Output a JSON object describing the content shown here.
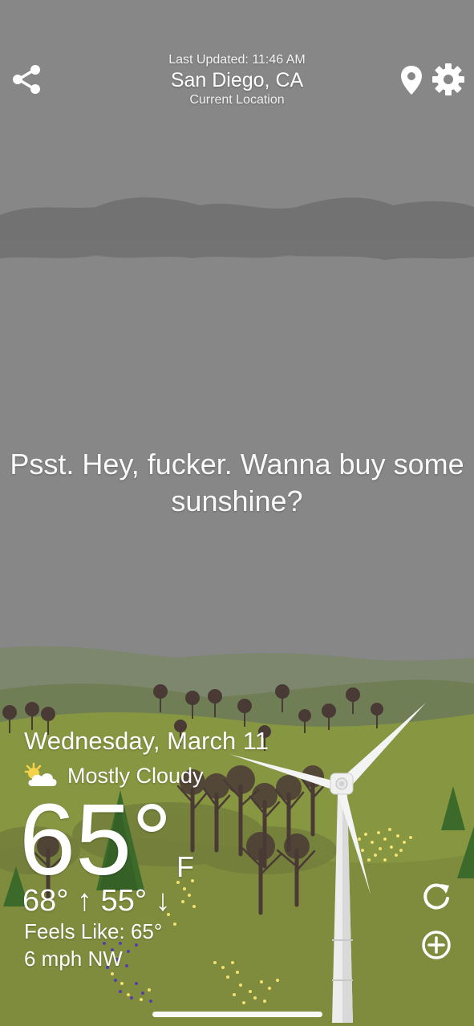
{
  "header": {
    "last_updated": "Last Updated: 11:46 AM",
    "location_name": "San Diego, CA",
    "location_subtitle": "Current Location"
  },
  "message": {
    "text": "Psst. Hey, fucker. Wanna buy some sunshine?"
  },
  "weather": {
    "date": "Wednesday, March 11",
    "condition": "Mostly Cloudy",
    "condition_icon": "partly-cloudy-icon",
    "temperature": "65°",
    "unit": "F",
    "high_low": "68° ↑ 55° ↓",
    "feels_like": "Feels Like: 65°",
    "wind": "6 mph NW"
  },
  "icons": {
    "share": "share-icon",
    "location": "location-pin-icon",
    "settings": "gear-icon",
    "refresh": "refresh-icon",
    "add": "add-circle-icon"
  },
  "colors": {
    "sky": "#878787",
    "cloud_band": "#737373",
    "hills_far": "#7c8a6c",
    "hills_near": "#8a9a4a",
    "ground": "#849341",
    "tree_trunk": "#4a3a36",
    "pine": "#3c6a2c",
    "flowers_yellow": "#f2e173",
    "flowers_purple": "#5a3ea6"
  }
}
